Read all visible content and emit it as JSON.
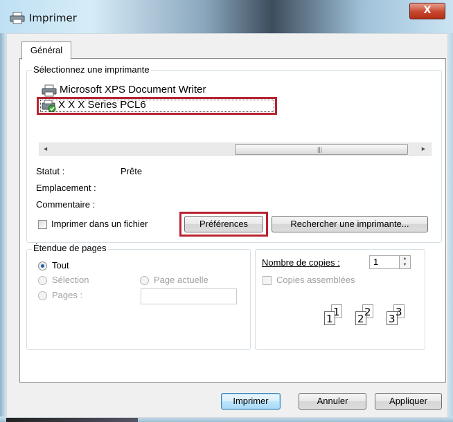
{
  "window": {
    "title": "Imprimer",
    "close_label": "X"
  },
  "tab": {
    "label": "Général"
  },
  "printer_group": {
    "label": "Sélectionnez une imprimante",
    "printers": [
      "Microsoft XPS Document Writer",
      "X X X Series PCL6"
    ],
    "selected_index": 1
  },
  "status": {
    "statut_label": "Statut :",
    "statut_value": "Prête",
    "emplacement_label": "Emplacement :",
    "commentaire_label": "Commentaire :"
  },
  "print_to_file": {
    "label": "Imprimer dans un fichier",
    "checked": false
  },
  "buttons": {
    "preferences": "Préférences",
    "find_printer": "Rechercher une imprimante...",
    "print": "Imprimer",
    "cancel": "Annuler",
    "apply": "Appliquer"
  },
  "page_range": {
    "label": "Étendue de pages",
    "all": "Tout",
    "selection": "Sélection",
    "current_page": "Page actuelle",
    "pages": "Pages :",
    "selected": "all",
    "pages_value": ""
  },
  "copies": {
    "label": "Nombre de copies :",
    "value": "1",
    "collate_label": "Copies assemblées",
    "collate_checked": false,
    "collate_pages": [
      "1",
      "1",
      "2",
      "2",
      "3",
      "3"
    ]
  },
  "colors": {
    "highlight_border": "#b8232f",
    "radio_dot": "#1f5fa8"
  }
}
